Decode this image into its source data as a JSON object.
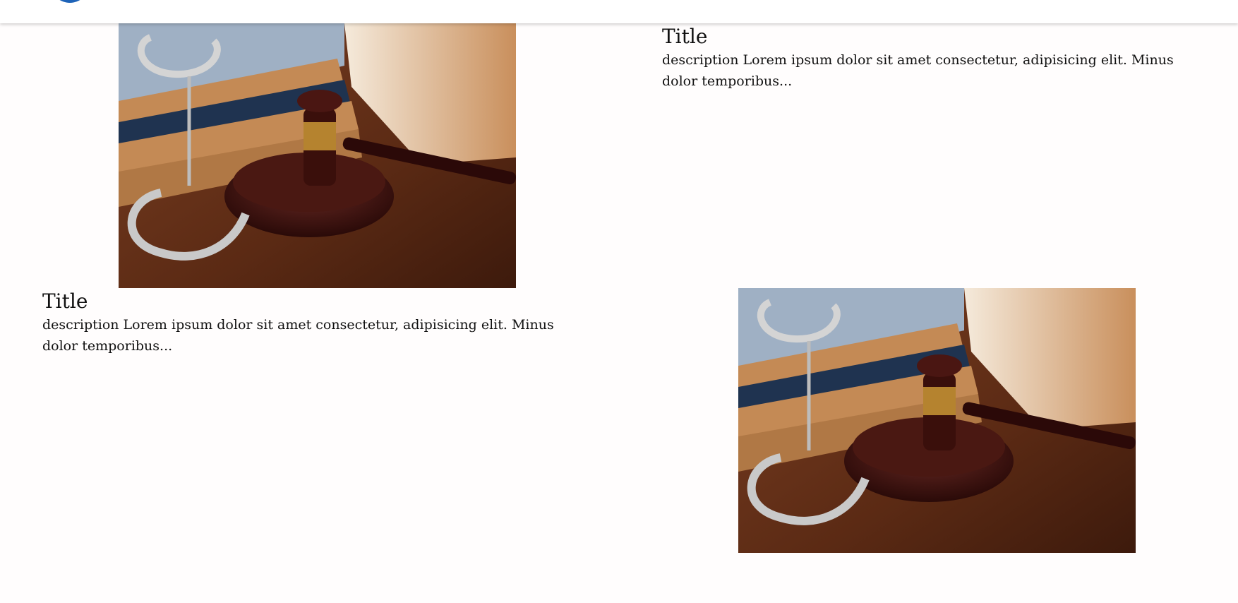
{
  "header": {
    "logo_icon": "circle-logo-icon",
    "logo_color": "#1e63b8"
  },
  "cards": [
    {
      "title": "Title",
      "description": "description Lorem ipsum dolor sit amet consectetur, adipisicing elit. Minus dolor temporibus...",
      "image": "law-gavel-books-handcuffs-image"
    },
    {
      "title": "Title",
      "description": "description Lorem ipsum dolor sit amet consectetur, adipisicing elit. Minus dolor temporibus...",
      "image": "law-gavel-books-handcuffs-image"
    }
  ]
}
